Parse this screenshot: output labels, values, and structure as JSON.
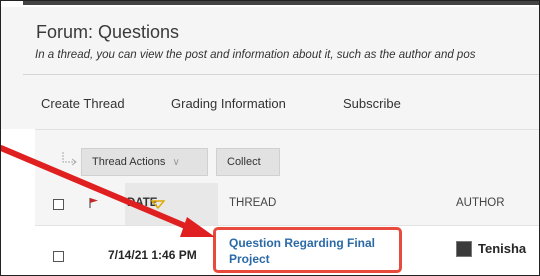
{
  "forum": {
    "title": "Forum: Questions",
    "subtitle": "In a thread, you can view the post and information about it, such as the author and pos"
  },
  "action_bar": {
    "create_thread": "Create Thread",
    "grading_information": "Grading Information",
    "subscribe": "Subscribe"
  },
  "toolbar": {
    "thread_actions": "Thread Actions",
    "collect": "Collect"
  },
  "table": {
    "headers": {
      "date": "DATE",
      "thread": "THREAD",
      "author": "AUTHOR"
    },
    "rows": [
      {
        "date": "7/14/21 1:46 PM",
        "thread": "Question Regarding Final Project",
        "author": "Tenisha"
      }
    ]
  },
  "colors": {
    "annotation_red": "#e02020",
    "link_blue": "#2b6aa6",
    "flag_red": "#c62828",
    "sort_triangle": "#e0a800"
  },
  "icons": {
    "select_all_arrow": "select-arrow-icon",
    "flag": "flag-icon",
    "sort": "sort-triangle-icon",
    "avatar": "avatar-icon"
  }
}
